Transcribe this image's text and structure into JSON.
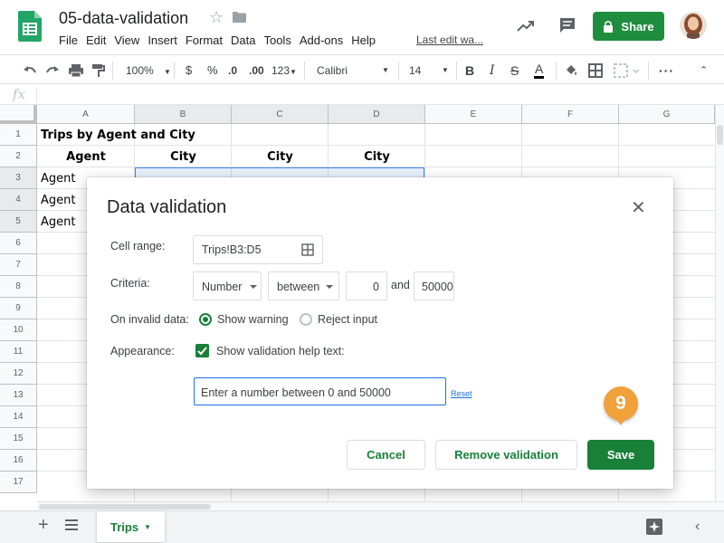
{
  "document": {
    "title": "05-data-validation",
    "last_edit": "Last edit wa..."
  },
  "menu": [
    "File",
    "Edit",
    "View",
    "Insert",
    "Format",
    "Data",
    "Tools",
    "Add-ons",
    "Help"
  ],
  "header": {
    "share_label": "Share"
  },
  "toolbar": {
    "zoom": "100%",
    "currency": "$",
    "percent": "%",
    "decimal_decrease": ".0",
    "decimal_increase": ".00",
    "more_formats": "123",
    "font": "Calibri",
    "font_size": "14",
    "bold": "B",
    "italic": "I",
    "underline_text": "A"
  },
  "formula_bar": {
    "fx": "fx",
    "value": ""
  },
  "grid": {
    "columns": [
      "A",
      "B",
      "C",
      "D",
      "E",
      "F",
      "G"
    ],
    "rows": [
      "1",
      "2",
      "3",
      "4",
      "5",
      "6",
      "7",
      "8",
      "9",
      "10",
      "11",
      "12",
      "13",
      "14",
      "15",
      "16",
      "17"
    ],
    "cells": {
      "A1": "Trips by Agent and City",
      "A2": "Agent",
      "B2": "City",
      "C2": "City",
      "D2": "City",
      "A3": "Agent",
      "A4": "Agent",
      "A5": "Agent"
    }
  },
  "sheet_tabs": {
    "active": "Trips"
  },
  "dialog": {
    "title": "Data validation",
    "cell_range_label": "Cell range:",
    "cell_range_value": "Trips!B3:D5",
    "criteria_label": "Criteria:",
    "criteria_type": "Number",
    "criteria_operator": "between",
    "criteria_min": "0",
    "criteria_and": "and",
    "criteria_max": "50000",
    "invalid_label": "On invalid data:",
    "option_show_warning": "Show warning",
    "option_reject_input": "Reject input",
    "invalid_selected": "Show warning",
    "appearance_label": "Appearance:",
    "show_help_text_label": "Show validation help text:",
    "show_help_text_checked": true,
    "help_text_value": "Enter a number between 0 and 50000",
    "reset_label": "Reset",
    "cancel_label": "Cancel",
    "remove_label": "Remove validation",
    "save_label": "Save"
  },
  "callout": {
    "step": "9"
  },
  "colors": {
    "accent_green": "#188038",
    "share_green": "#1e8e3e",
    "callout_orange": "#f0a13a",
    "selection_blue": "#4285f4"
  }
}
